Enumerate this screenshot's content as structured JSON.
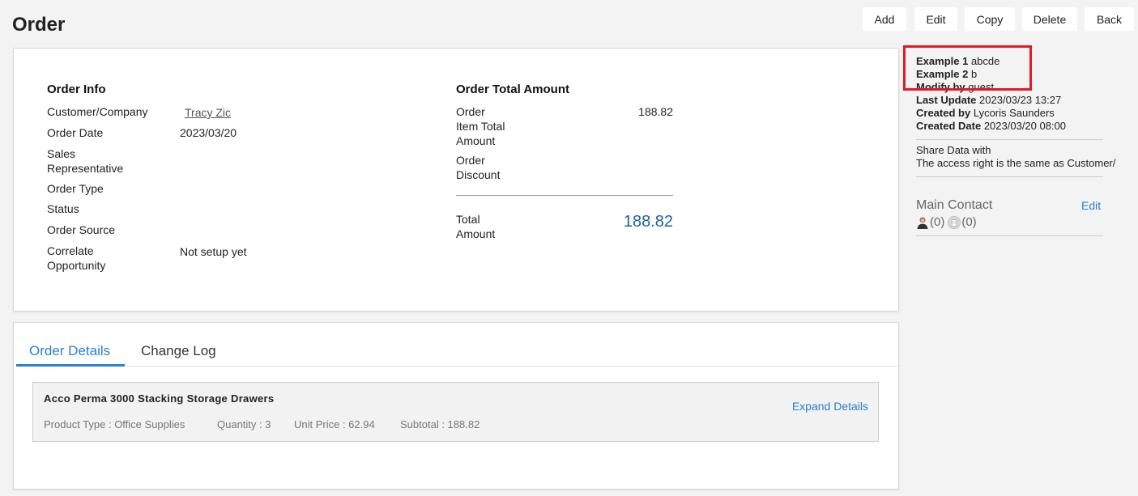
{
  "page": {
    "title": "Order"
  },
  "toolbar": {
    "add": "Add",
    "edit": "Edit",
    "copy": "Copy",
    "delete": "Delete",
    "back": "Back"
  },
  "order_info": {
    "title": "Order Info",
    "customer_label": "Customer/Company",
    "customer_value": "Tracy Zic",
    "date_label": "Order Date",
    "date_value": "2023/03/20",
    "sales_rep_label_1": "Sales",
    "sales_rep_label_2": "Representative",
    "type_label": "Order Type",
    "status_label": "Status",
    "source_label": "Order Source",
    "opportunity_label_1": "Correlate",
    "opportunity_label_2": "Opportunity",
    "opportunity_value": "Not setup yet"
  },
  "order_total": {
    "title": "Order Total Amount",
    "item_total_label_1": "Order",
    "item_total_label_2": "Item Total",
    "item_total_label_3": "Amount",
    "item_total_value": "188.82",
    "discount_label_1": "Order",
    "discount_label_2": "Discount",
    "total_label_1": "Total",
    "total_label_2": "Amount",
    "total_value": "188.82"
  },
  "tabs": {
    "details": "Order Details",
    "change_log": "Change Log"
  },
  "item": {
    "name": "Acco Perma 3000 Stacking Storage Drawers",
    "product_type": "Product Type : Office Supplies",
    "quantity": "Quantity : 3",
    "unit_price": "Unit Price : 62.94",
    "subtotal": "Subtotal : 188.82",
    "expand": "Expand Details"
  },
  "sidebar": {
    "ex1_label": "Example 1",
    "ex1_value": "abcde",
    "ex2_label": "Example 2",
    "ex2_value": "b",
    "modify_label": "Modify by",
    "modify_value": "guest",
    "last_update_label": "Last Update",
    "last_update_value": "2023/03/23 13:27",
    "created_by_label": "Created by",
    "created_by_value": "Lycoris Saunders",
    "created_date_label": "Created Date",
    "created_date_value": "2023/03/20 08:00",
    "share_label": "Share Data with",
    "share_value": "The access right is the same as Customer/",
    "main_contact": "Main Contact",
    "contact_edit": "Edit",
    "person_count": "(0)",
    "company_count": "(0)"
  },
  "colors": {
    "accent": "#2a7fd4",
    "total": "#1f5fa6",
    "highlight": "#e01b22"
  }
}
